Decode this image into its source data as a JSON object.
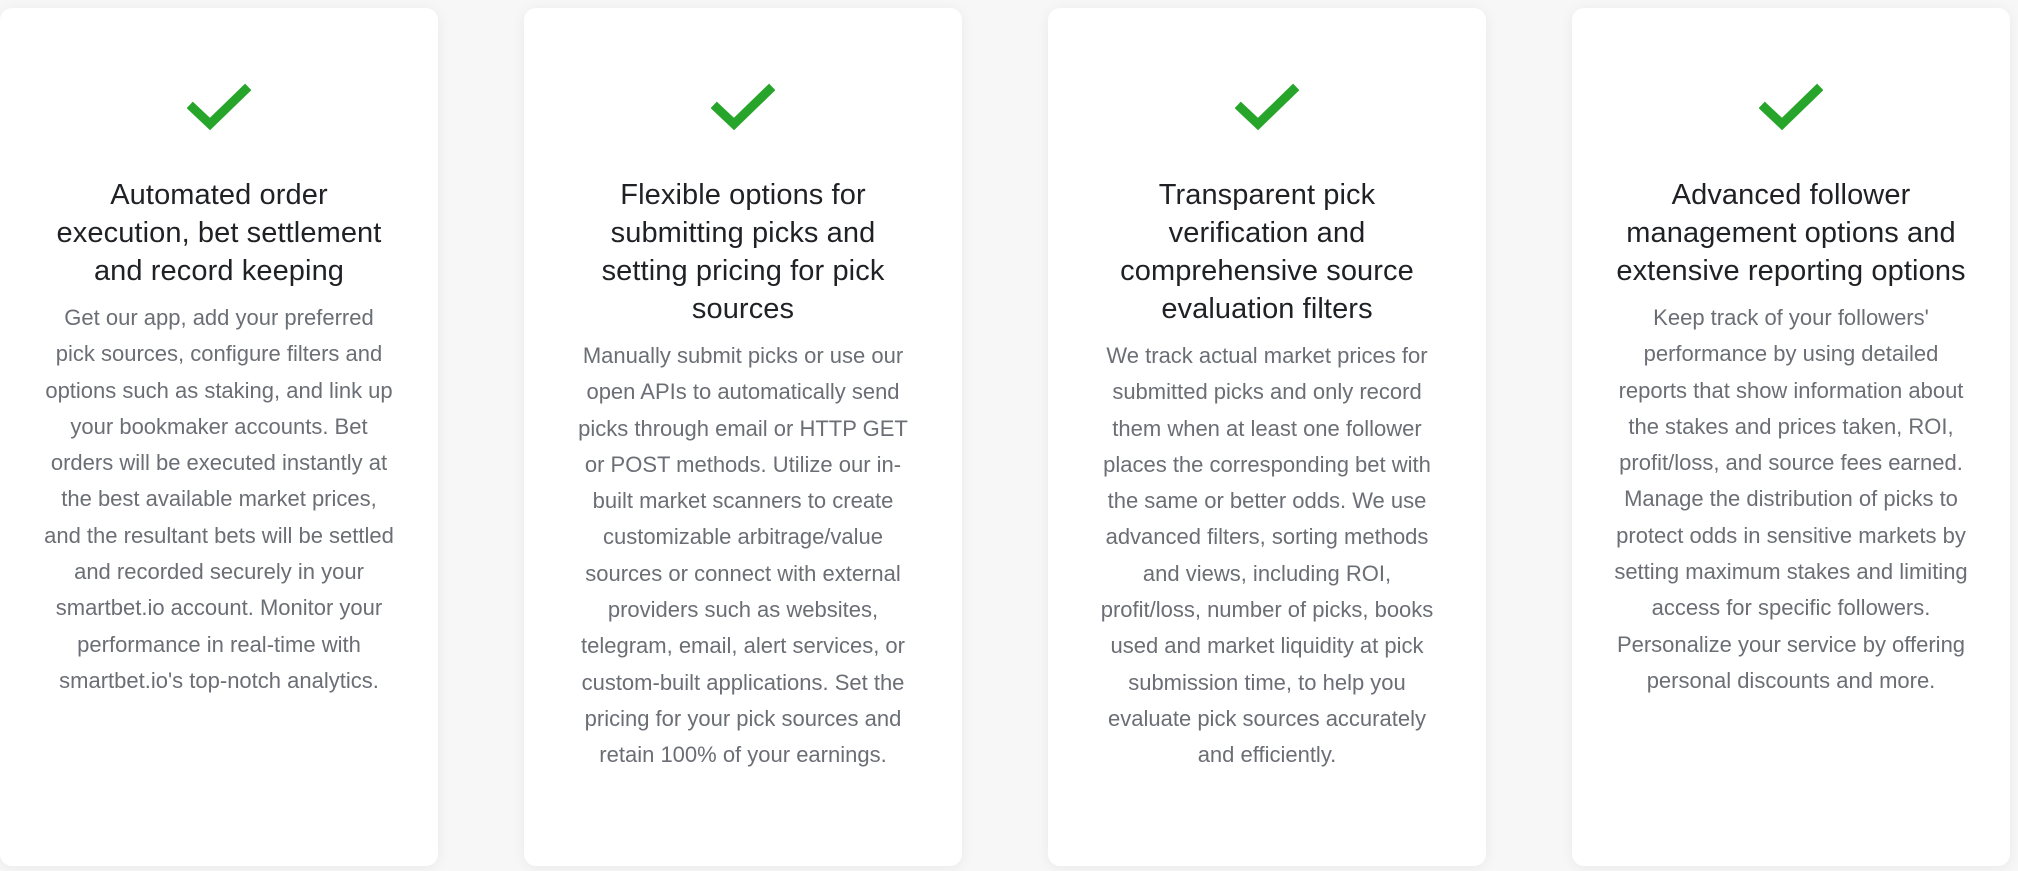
{
  "colors": {
    "check": "#27a52a",
    "title": "#1f2125",
    "body": "#6b6e75",
    "card_bg": "#ffffff",
    "page_bg": "#f7f7f8"
  },
  "cards": [
    {
      "icon": "checkmark-icon",
      "title": "Automated order execution, bet settlement and record keeping",
      "body": "Get our app, add your preferred pick sources, configure filters and options such as staking, and link up your bookmaker accounts. Bet orders will be executed instantly at the best available market prices, and the resultant bets will be settled and recorded securely in your smartbet.io account. Monitor your performance in real-time with smartbet.io's top-notch analytics."
    },
    {
      "icon": "checkmark-icon",
      "title": "Flexible options for submitting picks and setting pricing for pick sources",
      "body": "Manually submit picks or use our open APIs to automatically send picks through email or HTTP GET or POST methods. Utilize our in-built market scanners to create customizable arbitrage/value sources or connect with external providers such as websites, telegram, email, alert services, or custom-built applications. Set the pricing for your pick sources and retain 100% of your earnings."
    },
    {
      "icon": "checkmark-icon",
      "title": "Transparent pick verification and comprehensive source evaluation filters",
      "body": "We track actual market prices for submitted picks and only record them when at least one follower places the corresponding bet with the same or better odds. We use advanced filters, sorting methods and views, including ROI, profit/loss, number of picks, books used and market liquidity at pick submission time, to help you evaluate pick sources accurately and efficiently."
    },
    {
      "icon": "checkmark-icon",
      "title": "Advanced follower management options and extensive reporting options",
      "body": "Keep track of your followers' performance by using detailed reports that show information about the stakes and prices taken, ROI, profit/loss, and source fees earned. Manage the distribution of picks to protect odds in sensitive markets by setting maximum stakes and limiting access for specific followers. Personalize your service by offering personal discounts and more."
    }
  ]
}
